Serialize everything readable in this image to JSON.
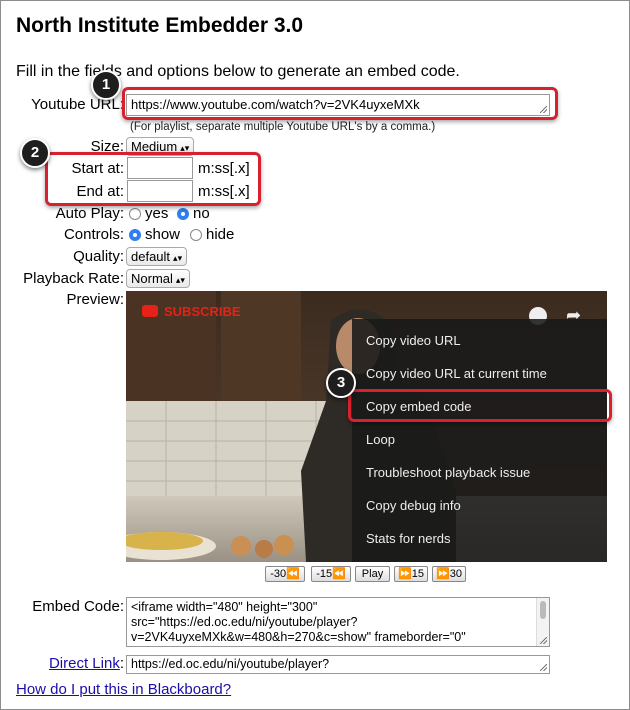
{
  "title": "North Institute Embedder 3.0",
  "intro": "Fill in the fields and options below to generate an embed code.",
  "fields": {
    "youtube_url_label": "Youtube URL:",
    "youtube_url_value": "https://www.youtube.com/watch?v=2VK4uyxeMXk",
    "playlist_hint": "(For playlist, separate multiple Youtube URL's by a comma.)",
    "size_label": "Size:",
    "size_value": "Medium",
    "start_label": "Start at:",
    "end_label": "End at:",
    "time_format": "m:ss[.x]",
    "autoplay_label": "Auto Play:",
    "autoplay_options": [
      "yes",
      "no"
    ],
    "autoplay_selected": "no",
    "controls_label": "Controls:",
    "controls_options": [
      "show",
      "hide"
    ],
    "controls_selected": "show",
    "quality_label": "Quality:",
    "quality_value": "default",
    "playback_label": "Playback Rate:",
    "playback_value": "Normal",
    "preview_label": "Preview:"
  },
  "video": {
    "subscribe_label": "SUBSCRIBE",
    "context_menu": [
      "Copy video URL",
      "Copy video URL at current time",
      "Copy embed code",
      "Loop",
      "Troubleshoot playback issue",
      "Copy debug info",
      "Stats for nerds"
    ],
    "highlighted_item": "Copy embed code",
    "controls": [
      "-30",
      "-15",
      "Play",
      "15",
      "30"
    ]
  },
  "embed": {
    "label": "Embed Code:",
    "code": "<iframe width=\"480\" height=\"300\" src=\"https://ed.oc.edu/ni/youtube/player?v=2VK4uyxeMXk&w=480&h=270&c=show\" frameborder=\"0\""
  },
  "direct_link": {
    "label": "Direct Link",
    "colon": ":",
    "value": "https://ed.oc.edu/ni/youtube/player?"
  },
  "help_link": "How do I put this in Blackboard?",
  "callouts": [
    "1",
    "2",
    "3"
  ],
  "colors": {
    "callout": "#d8212f",
    "link": "#1a0dab",
    "radio": "#2f7ff0"
  }
}
